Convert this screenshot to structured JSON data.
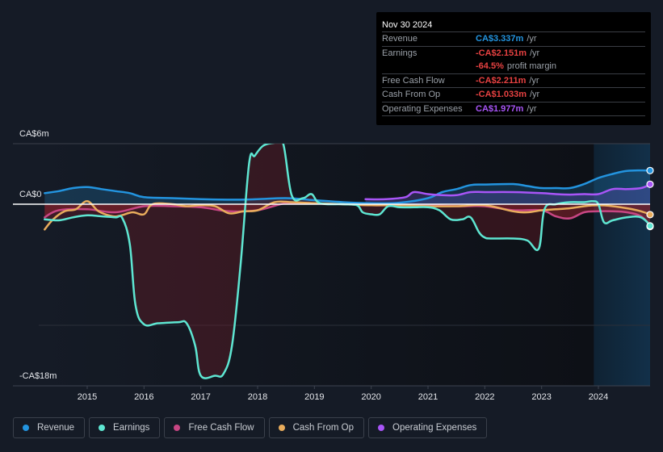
{
  "tooltip": {
    "date": "Nov 30 2024",
    "rows": [
      {
        "label": "Revenue",
        "value": "CA$3.337m",
        "unit": "/yr",
        "color": "#2394df"
      },
      {
        "label": "Earnings",
        "value": "-CA$2.151m",
        "unit": "/yr",
        "color": "#e64141"
      },
      {
        "label": "",
        "value": "-64.5%",
        "unit": "profit margin",
        "color": "#e64141"
      },
      {
        "label": "Free Cash Flow",
        "value": "-CA$2.211m",
        "unit": "/yr",
        "color": "#e64141"
      },
      {
        "label": "Cash From Op",
        "value": "-CA$1.033m",
        "unit": "/yr",
        "color": "#e64141"
      },
      {
        "label": "Operating Expenses",
        "value": "CA$1.977m",
        "unit": "/yr",
        "color": "#a855f7"
      }
    ]
  },
  "legend": [
    {
      "label": "Revenue",
      "color": "#2394df"
    },
    {
      "label": "Earnings",
      "color": "#5ee6d2"
    },
    {
      "label": "Free Cash Flow",
      "color": "#c74683"
    },
    {
      "label": "Cash From Op",
      "color": "#e8ac5c"
    },
    {
      "label": "Operating Expenses",
      "color": "#a855f7"
    }
  ],
  "chart_data": {
    "type": "line",
    "title": "",
    "xlabel": "",
    "ylabel": "",
    "y_tick_labels": [
      "CA$6m",
      "CA$0",
      "-CA$18m"
    ],
    "y_ticks": [
      6,
      0,
      -18
    ],
    "ylim": [
      -18,
      6
    ],
    "xlim": [
      2014.25,
      2024.92
    ],
    "x_tick_labels": [
      "2015",
      "2016",
      "2017",
      "2018",
      "2019",
      "2020",
      "2021",
      "2022",
      "2023",
      "2024"
    ],
    "x_ticks": [
      2015,
      2016,
      2017,
      2018,
      2019,
      2020,
      2021,
      2022,
      2023,
      2024
    ],
    "forecast_region_start": 2023.92,
    "series": [
      {
        "name": "Revenue",
        "color": "#2394df",
        "x": [
          2014.25,
          2014.5,
          2014.75,
          2015.0,
          2015.25,
          2015.5,
          2015.75,
          2016.0,
          2016.5,
          2017.0,
          2017.5,
          2018.0,
          2018.5,
          2019.0,
          2019.5,
          2020.0,
          2020.5,
          2021.0,
          2021.25,
          2021.5,
          2021.75,
          2022.0,
          2022.5,
          2022.75,
          2023.0,
          2023.25,
          2023.5,
          2023.75,
          2024.0,
          2024.25,
          2024.5,
          2024.75,
          2024.92
        ],
        "y": [
          1.1,
          1.3,
          1.6,
          1.7,
          1.5,
          1.3,
          1.1,
          0.7,
          0.6,
          0.5,
          0.45,
          0.5,
          0.6,
          0.4,
          0.2,
          0.1,
          0.15,
          0.6,
          1.2,
          1.5,
          1.9,
          1.95,
          2.0,
          1.8,
          1.6,
          1.6,
          1.6,
          2.0,
          2.6,
          3.0,
          3.3,
          3.35,
          3.337
        ]
      },
      {
        "name": "Earnings",
        "color": "#5ee6d2",
        "x": [
          2014.25,
          2014.5,
          2014.75,
          2015.0,
          2015.25,
          2015.5,
          2015.62,
          2015.75,
          2015.85,
          2016.0,
          2016.25,
          2016.6,
          2016.75,
          2016.9,
          2017.0,
          2017.25,
          2017.4,
          2017.55,
          2017.7,
          2017.85,
          2017.95,
          2018.1,
          2018.3,
          2018.45,
          2018.6,
          2018.8,
          2018.95,
          2019.1,
          2019.5,
          2019.75,
          2019.85,
          2020.0,
          2020.15,
          2020.3,
          2020.5,
          2020.75,
          2021.0,
          2021.2,
          2021.4,
          2021.6,
          2021.75,
          2021.9,
          2022.0,
          2022.1,
          2022.5,
          2022.75,
          2022.95,
          2023.05,
          2023.25,
          2023.5,
          2023.75,
          2023.9,
          2024.0,
          2024.1,
          2024.25,
          2024.5,
          2024.75,
          2024.92
        ],
        "y": [
          -1.5,
          -1.6,
          -1.3,
          -1.1,
          -1.2,
          -1.3,
          -1.4,
          -4.0,
          -10.0,
          -11.9,
          -11.8,
          -11.7,
          -11.8,
          -14.0,
          -17.0,
          -17.0,
          -16.8,
          -14.0,
          -6.0,
          4.0,
          4.8,
          5.8,
          6.1,
          6.0,
          0.9,
          0.6,
          1.0,
          0.1,
          0.0,
          -0.1,
          -0.8,
          -1.0,
          -1.0,
          -0.2,
          -0.3,
          -0.3,
          -0.3,
          -0.6,
          -1.5,
          -1.5,
          -1.3,
          -2.8,
          -3.3,
          -3.4,
          -3.4,
          -3.6,
          -4.4,
          -0.5,
          0.0,
          0.2,
          0.2,
          0.3,
          0.0,
          -1.8,
          -1.6,
          -1.3,
          -1.3,
          -2.151
        ]
      },
      {
        "name": "Free Cash Flow",
        "color": "#c74683",
        "x": [
          2014.25,
          2014.5,
          2015.0,
          2015.5,
          2016.0,
          2016.5,
          2017.0,
          2017.5,
          2018.0,
          2018.5,
          2019.0,
          2019.5,
          2020.0,
          2020.5,
          2021.0,
          2021.5,
          2022.0,
          2022.5,
          2023.0,
          2023.25,
          2023.5,
          2023.75,
          2024.0,
          2024.25,
          2024.5,
          2024.75,
          2024.92
        ],
        "y": [
          -1.3,
          -0.6,
          -0.5,
          -0.8,
          -0.2,
          -0.2,
          -0.3,
          -0.7,
          -0.6,
          0.1,
          0.1,
          0.0,
          -0.1,
          -0.1,
          -0.1,
          -0.2,
          -0.2,
          -0.6,
          -0.6,
          -1.2,
          -1.4,
          -0.8,
          -0.7,
          -0.7,
          -0.8,
          -1.2,
          -2.211
        ]
      },
      {
        "name": "Cash From Op",
        "color": "#e8ac5c",
        "x": [
          2014.25,
          2014.4,
          2014.6,
          2014.8,
          2015.0,
          2015.2,
          2015.45,
          2015.6,
          2015.8,
          2016.0,
          2016.15,
          2016.5,
          2016.75,
          2017.0,
          2017.25,
          2017.5,
          2017.75,
          2018.0,
          2018.3,
          2018.6,
          2019.0,
          2019.5,
          2020.0,
          2020.5,
          2021.0,
          2021.5,
          2022.0,
          2022.5,
          2022.75,
          2023.0,
          2023.25,
          2023.5,
          2023.75,
          2024.0,
          2024.25,
          2024.5,
          2024.75,
          2024.92
        ],
        "y": [
          -2.5,
          -1.5,
          -0.7,
          -0.5,
          0.3,
          -0.7,
          -1.2,
          -1.1,
          -0.8,
          -1.0,
          0.0,
          0.0,
          -0.2,
          -0.1,
          -0.2,
          -0.9,
          -0.7,
          -0.6,
          0.2,
          0.2,
          0.1,
          0.0,
          -0.1,
          -0.1,
          -0.2,
          -0.2,
          -0.1,
          -0.7,
          -0.8,
          -0.6,
          -0.5,
          -0.4,
          -0.2,
          -0.1,
          -0.2,
          -0.4,
          -0.7,
          -1.033
        ]
      },
      {
        "name": "Operating Expenses",
        "color": "#a855f7",
        "x": [
          2019.9,
          2020.25,
          2020.6,
          2020.75,
          2021.0,
          2021.25,
          2021.5,
          2021.75,
          2022.0,
          2022.5,
          2023.0,
          2023.25,
          2023.5,
          2023.75,
          2024.0,
          2024.25,
          2024.5,
          2024.75,
          2024.92
        ],
        "y": [
          0.5,
          0.5,
          0.7,
          1.2,
          1.0,
          0.9,
          0.9,
          1.2,
          1.2,
          1.2,
          1.1,
          1.0,
          0.95,
          1.0,
          1.0,
          1.5,
          1.5,
          1.6,
          1.977
        ]
      }
    ]
  }
}
